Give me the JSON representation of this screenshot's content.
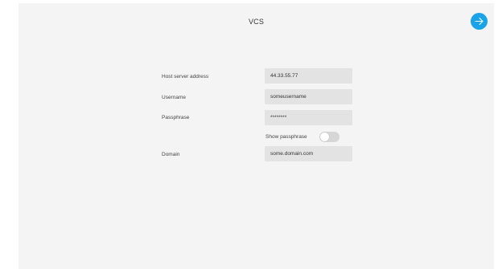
{
  "header": {
    "title": "VCS",
    "next_icon": "arrow-right-icon",
    "accent_color": "#1aa3e8"
  },
  "form": {
    "host": {
      "label": "Host server address",
      "value": "44.33.55.77"
    },
    "username": {
      "label": "Username",
      "value": "someusername"
    },
    "passphrase": {
      "label": "Passphrase",
      "value": "********"
    },
    "show_passphrase": {
      "label": "Show passphrase",
      "enabled": false
    },
    "domain": {
      "label": "Domain",
      "value": "some.domain.com"
    }
  }
}
